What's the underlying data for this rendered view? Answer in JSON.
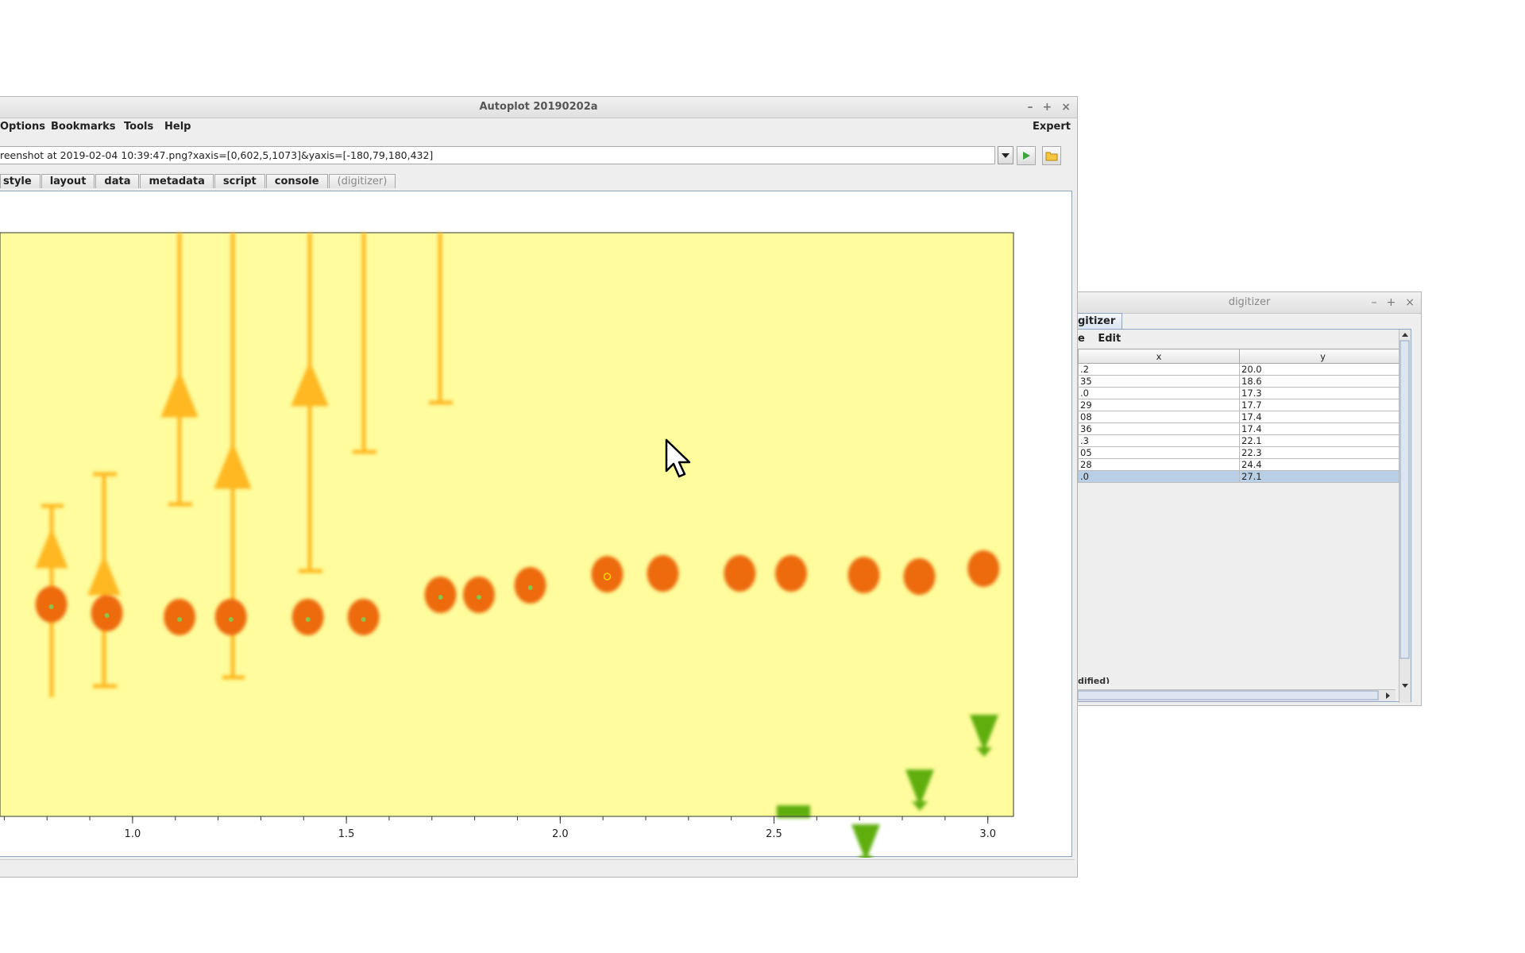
{
  "main_window": {
    "title": "Autoplot 20190202a",
    "menu": [
      "Options",
      "Bookmarks",
      "Tools",
      "Help"
    ],
    "expert_label": "Expert",
    "url": "reenshot at 2019-02-04 10:39:47.png?xaxis=[0,602,5,1073]&yaxis=[-180,79,180,432]",
    "tabs": [
      "style",
      "layout",
      "data",
      "metadata",
      "script",
      "console",
      "(digitizer)"
    ],
    "controls": {
      "minimize": "–",
      "maximize": "+",
      "close": "×"
    }
  },
  "chart_data": {
    "type": "scatter",
    "title": "",
    "xlabel": "",
    "ylabel": "",
    "x_ticks": [
      "1.0",
      "1.5",
      "2.0",
      "2.5",
      "3.0"
    ],
    "xlim": [
      0.69,
      3.06
    ],
    "background_color": "#fefc9c",
    "colors": {
      "orange": "#ed6a08",
      "amber": "#ffb820",
      "green": "#5fae0c",
      "digitized_marker": "#8bc34a"
    },
    "series": [
      {
        "marker": "circle",
        "x": [
          0.81,
          0.94,
          1.11,
          1.23,
          1.41,
          1.54,
          1.72,
          1.81,
          1.93,
          2.11,
          2.24,
          2.42,
          2.54,
          2.71,
          2.84,
          2.99
        ],
        "y": [
          0,
          0,
          0,
          0,
          0,
          0,
          0,
          0,
          0,
          0,
          0,
          0,
          0,
          0,
          0,
          0
        ]
      }
    ],
    "digitized_x": [
      0.81,
      0.94,
      1.11,
      1.23,
      1.41,
      1.54,
      1.72,
      1.81,
      1.93,
      2.11
    ]
  },
  "digitizer": {
    "title": "digitizer",
    "tab_label": "gitizer",
    "menu": [
      "e",
      "Edit"
    ],
    "columns": [
      "x",
      "y"
    ],
    "rows": [
      {
        "x": ".2",
        "y": "20.0"
      },
      {
        "x": "35",
        "y": "18.6"
      },
      {
        "x": ".0",
        "y": "17.3"
      },
      {
        "x": "29",
        "y": "17.7"
      },
      {
        "x": "08",
        "y": "17.4"
      },
      {
        "x": "36",
        "y": "17.4"
      },
      {
        "x": ".3",
        "y": "22.1"
      },
      {
        "x": "05",
        "y": "22.3"
      },
      {
        "x": "28",
        "y": "24.4"
      },
      {
        "x": ".0",
        "y": "27.1"
      }
    ],
    "selected_row": 9,
    "status": "dified)"
  }
}
